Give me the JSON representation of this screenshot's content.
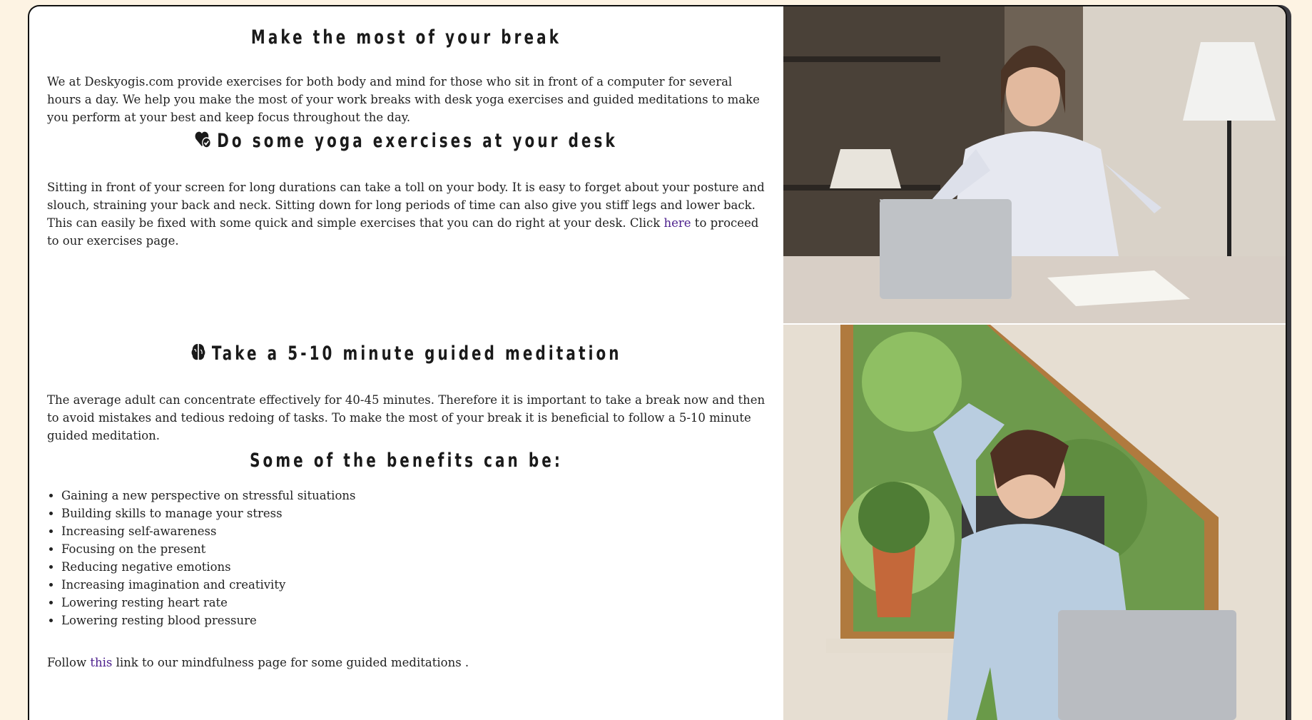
{
  "sections": {
    "break": {
      "heading": "Make the most of your break",
      "intro": "We at Deskyogis.com provide exercises for both body and mind for those who sit in front of a computer for several hours a day. We help you make the most of your work breaks with desk yoga exercises and guided meditations to make you perform at your best and keep focus throughout the day."
    },
    "yoga": {
      "heading": "Do some yoga exercises at your desk",
      "icon": "heart-check-icon",
      "text_before_link": "Sitting in front of your screen for long durations can take a toll on your body. It is easy to forget about your posture and slouch, straining your back and neck. Sitting down for long periods of time can also give you stiff legs and lower back. This can easily be fixed with some quick and simple exercises that you can do right at your desk. Click ",
      "link_text": "here",
      "text_after_link": " to proceed to our exercises page."
    },
    "meditation": {
      "heading": "Take a 5-10 minute guided meditation",
      "icon": "brain-icon",
      "text": "The average adult can concentrate effectively for 40-45 minutes. Therefore it is important to take a break now and then to avoid mistakes and tedious redoing of tasks. To make the most of your break it is beneficial to follow a 5-10 minute guided meditation."
    },
    "benefits": {
      "heading": "Some of the benefits can be:",
      "items": [
        "Gaining a new perspective on stressful situations",
        "Building skills to manage your stress",
        "Increasing self-awareness",
        "Focusing on the present",
        "Reducing negative emotions",
        "Increasing imagination and creativity",
        "Lowering resting heart rate",
        "Lowering resting blood pressure"
      ]
    },
    "follow": {
      "before": "Follow ",
      "link_text": "this",
      "after": " link to our mindfulness page for some guided meditations ."
    }
  },
  "colors": {
    "page_background": "#fdf3e3",
    "link": "#4b1e8c",
    "card": "#ffffff"
  }
}
